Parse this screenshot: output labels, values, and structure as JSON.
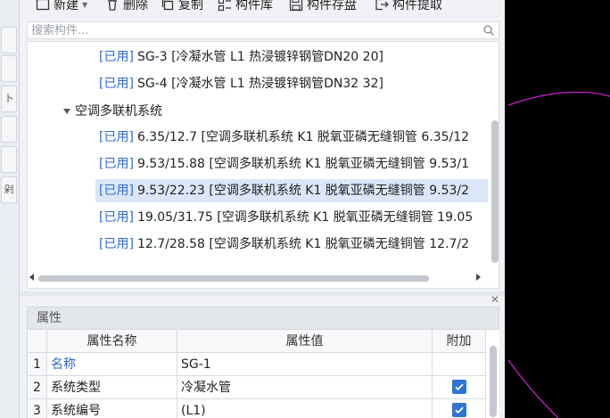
{
  "toolbar": {
    "new_label": "新建",
    "delete_label": "删除",
    "copy_label": "复制",
    "library_label": "构件库",
    "save_label": "构件存盘",
    "extract_label": "构件提取"
  },
  "left_strip": {
    "labels": [
      "卜",
      "",
      "",
      "剁"
    ]
  },
  "search": {
    "placeholder": "搜索构件..."
  },
  "tree": {
    "group_label": "空调多联机系统",
    "items_top": [
      {
        "tag": "[已用]",
        "text": "SG-3 [冷凝水管 L1 热浸镀锌钢管DN20 20]"
      },
      {
        "tag": "[已用]",
        "text": "SG-4 [冷凝水管 L1 热浸镀锌钢管DN32 32]"
      }
    ],
    "items_group": [
      {
        "tag": "[已用]",
        "text": "6.35/12.7 [空调多联机系统 K1 脱氧亚磷无缝铜管 6.35/12"
      },
      {
        "tag": "[已用]",
        "text": "9.53/15.88 [空调多联机系统 K1 脱氧亚磷无缝铜管 9.53/1"
      },
      {
        "tag": "[已用]",
        "text": "9.53/22.23 [空调多联机系统 K1 脱氧亚磷无缝铜管 9.53/2",
        "selected": true
      },
      {
        "tag": "[已用]",
        "text": "19.05/31.75 [空调多联机系统 K1 脱氧亚磷无缝铜管 19.05"
      },
      {
        "tag": "[已用]",
        "text": "12.7/28.58 [空调多联机系统 K1 脱氧亚磷无缝铜管 12.7/2"
      }
    ]
  },
  "properties": {
    "title": "属性",
    "columns": [
      "属性名称",
      "属性值",
      "附加"
    ],
    "rows": [
      {
        "num": "1",
        "name": "名称",
        "value": "SG-1",
        "extra": false,
        "name_blue": true
      },
      {
        "num": "2",
        "name": "系统类型",
        "value": "冷凝水管",
        "extra": true
      },
      {
        "num": "3",
        "name": "系统编号",
        "value": "(L1)",
        "extra": true
      }
    ]
  },
  "colors": {
    "accent": "#2f75d4",
    "used_tag": "#2d6ad0",
    "selection": "#dbe7f8",
    "cad_arc": "#d020d0"
  }
}
